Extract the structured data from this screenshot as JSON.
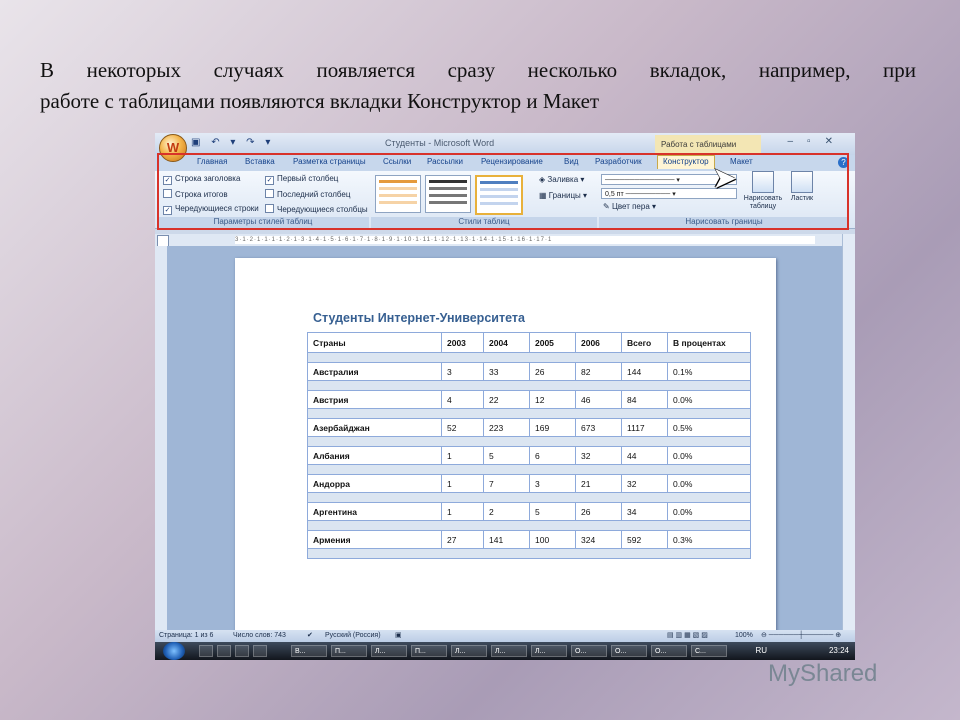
{
  "slide": {
    "line1": "В некоторых случаях появляется сразу несколько вкладок, например, при",
    "line2": "работе с таблицами появляются вкладки Конструктор и Макет"
  },
  "window": {
    "title": "Студенты - Microsoft Word",
    "context_title": "Работа с таблицами",
    "office_button": "W",
    "quick_access": "▣ ↶ ▾ ↷ ▾"
  },
  "tabs": [
    "Главная",
    "Вставка",
    "Разметка страницы",
    "Ссылки",
    "Рассылки",
    "Рецензирование",
    "Вид",
    "Разработчик",
    "Конструктор",
    "Макет"
  ],
  "active_tab": "Конструктор",
  "ribbon": {
    "style_options": {
      "items": [
        {
          "label": "Строка заголовка",
          "checked": true
        },
        {
          "label": "Строка итогов",
          "checked": false
        },
        {
          "label": "Чередующиеся строки",
          "checked": true
        },
        {
          "label": "Первый столбец",
          "checked": true
        },
        {
          "label": "Последний столбец",
          "checked": false
        },
        {
          "label": "Чередующиеся столбцы",
          "checked": false
        }
      ],
      "group_label": "Параметры стилей таблиц"
    },
    "table_styles": {
      "shading": "Заливка",
      "borders": "Границы",
      "group_label": "Стили таблиц"
    },
    "draw_borders": {
      "line_width": "0,5 пт",
      "pen_color": "Цвет пера",
      "draw_table": "Нарисовать таблицу",
      "eraser": "Ластик",
      "group_label": "Нарисовать границы"
    }
  },
  "ruler_scale": "3·1·2·1·1·1·1·2·1·3·1·4·1·5·1·6·1·7·1·8·1·9·1·10·1·11·1·12·1·13·1·14·1·15·1·16·1·17·1",
  "document": {
    "title": "Студенты Интернет-Университета",
    "headers": [
      "Страны",
      "2003",
      "2004",
      "2005",
      "2006",
      "Всего",
      "В процентах"
    ],
    "rows": [
      [
        "Австралия",
        "3",
        "33",
        "26",
        "82",
        "144",
        "0.1%"
      ],
      [
        "Австрия",
        "4",
        "22",
        "12",
        "46",
        "84",
        "0.0%"
      ],
      [
        "Азербайджан",
        "52",
        "223",
        "169",
        "673",
        "1117",
        "0.5%"
      ],
      [
        "Албания",
        "1",
        "5",
        "6",
        "32",
        "44",
        "0.0%"
      ],
      [
        "Андорра",
        "1",
        "7",
        "3",
        "21",
        "32",
        "0.0%"
      ],
      [
        "Аргентина",
        "1",
        "2",
        "5",
        "26",
        "34",
        "0.0%"
      ],
      [
        "Армения",
        "27",
        "141",
        "100",
        "324",
        "592",
        "0.3%"
      ]
    ]
  },
  "status": {
    "page": "Страница: 1 из 6",
    "words": "Число слов: 743",
    "language": "Русский (Россия)",
    "zoom": "100%"
  },
  "taskbar": {
    "items": [
      "В...",
      "П...",
      "Л...",
      "П...",
      "Л...",
      "Л...",
      "Л...",
      "О...",
      "О...",
      "О...",
      "С..."
    ],
    "lang": "RU",
    "time": "23:24"
  },
  "watermark": "MyShared"
}
